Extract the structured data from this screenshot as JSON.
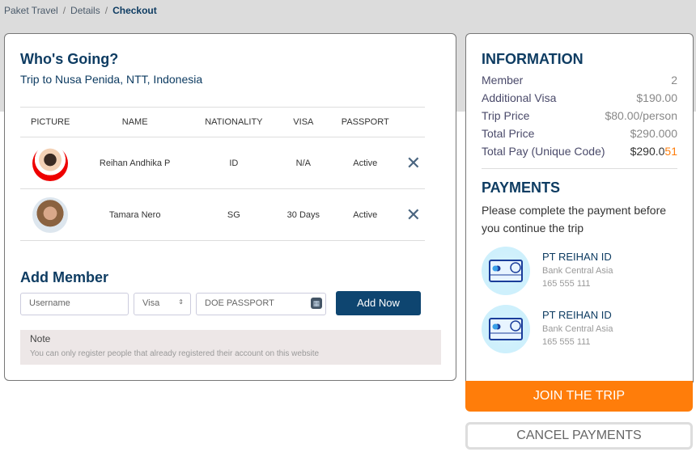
{
  "breadcrumb": [
    "Paket Travel",
    "Details",
    "Checkout"
  ],
  "left": {
    "title": "Who's Going?",
    "subtitle": "Trip to Nusa Penida, NTT, Indonesia",
    "columns": [
      "PICTURE",
      "NAME",
      "NATIONALITY",
      "VISA",
      "PASSPORT"
    ],
    "rows": [
      {
        "name": "Reihan Andhika P",
        "nationality": "ID",
        "visa": "N/A",
        "passport": "Active"
      },
      {
        "name": "Tamara Nero",
        "nationality": "SG",
        "visa": "30 Days",
        "passport": "Active"
      }
    ],
    "add_title": "Add Member",
    "username_placeholder": "Username",
    "visa_select": "Visa",
    "passport_placeholder": "DOE PASSPORT",
    "add_button": "Add Now",
    "note_title": "Note",
    "note_text": "You can only register people that already registered their account on this website"
  },
  "info": {
    "title": "INFORMATION",
    "rows": [
      {
        "label": "Member",
        "value": "2"
      },
      {
        "label": "Additional Visa",
        "value": "$190.00"
      },
      {
        "label": "Trip Price",
        "value": "$80.00/person"
      },
      {
        "label": "Total Price",
        "value": "$290.000"
      }
    ],
    "total_label": "Total Pay (Unique Code)",
    "total_main": "$290.0",
    "total_code": "51"
  },
  "payments": {
    "title": "PAYMENTS",
    "text": "Please complete the payment before you continue the trip",
    "banks": [
      {
        "name": "PT REIHAN ID",
        "bank": "Bank Central Asia",
        "number": "165 555 111"
      },
      {
        "name": "PT REIHAN ID",
        "bank": "Bank Central Asia",
        "number": "165 555 111"
      }
    ]
  },
  "join_button": "JOIN THE TRIP",
  "cancel_button": "CANCEL PAYMENTS",
  "colors": {
    "primary": "#0e3c62",
    "accent": "#ff7d0a"
  }
}
